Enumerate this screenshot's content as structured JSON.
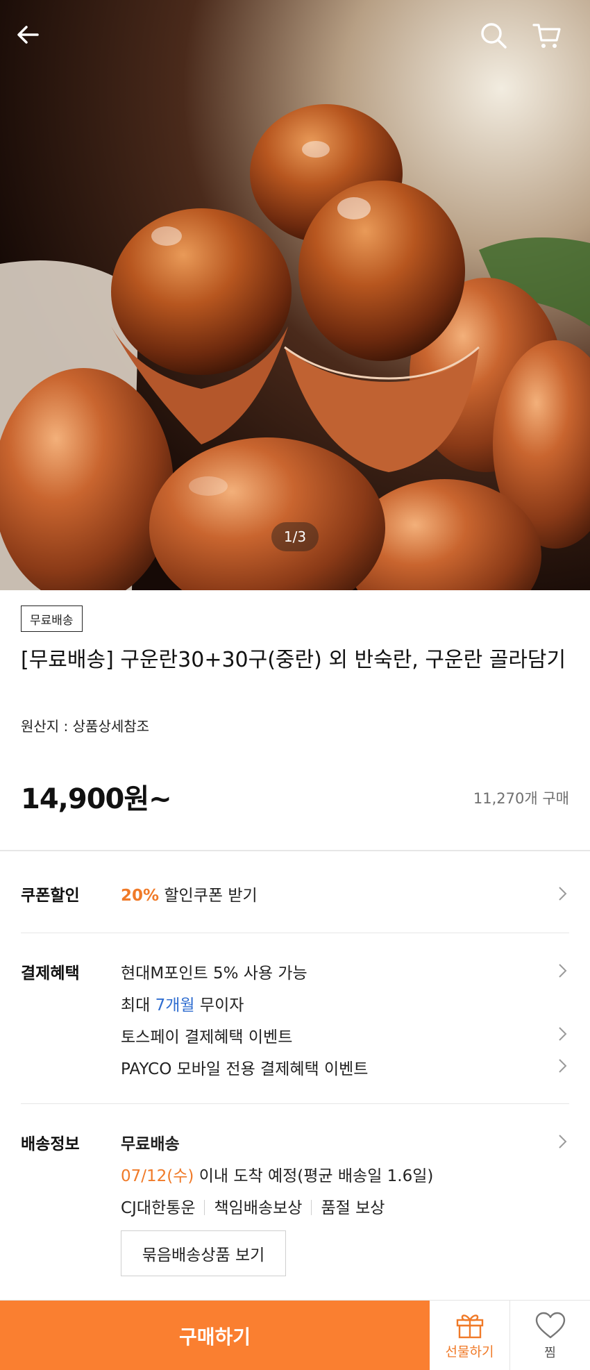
{
  "header": {
    "back_icon": "back-arrow-icon",
    "search_icon": "search-icon",
    "cart_icon": "cart-icon"
  },
  "gallery": {
    "indicator": "1/3"
  },
  "product": {
    "badge": "무료배송",
    "title": "[무료배송] 구운란30+30구(중란) 외 반숙란, 구운란 골라담기",
    "origin": "원산지 : 상품상세참조",
    "price": "14,900원~",
    "purchases": "11,270개 구매"
  },
  "coupon": {
    "label": "쿠폰할인",
    "percent": "20%",
    "text": " 할인쿠폰 받기"
  },
  "payment": {
    "label": "결제혜택",
    "line1": "현대M포인트 5% 사용 가능",
    "line2_prefix": "최대 ",
    "line2_highlight": "7개월",
    "line2_suffix": " 무이자",
    "line3": "토스페이 결제혜택 이벤트",
    "line4": "PAYCO 모바일 전용 결제혜택 이벤트"
  },
  "shipping": {
    "label": "배송정보",
    "title": "무료배송",
    "date_highlight": "07/12(수)",
    "date_suffix": " 이내 도착 예정(평균 배송일 1.6일)",
    "carrier": "CJ대한통운",
    "guarantee": "책임배송보상",
    "soldout": "품절 보상",
    "bundle_button": "묶음배송상품 보기"
  },
  "bottom_bar": {
    "buy": "구매하기",
    "gift": "선물하기",
    "wish": "찜"
  },
  "colors": {
    "accent_orange": "#fa7f30",
    "text_orange": "#f07a28",
    "link_blue": "#2f6dd0"
  }
}
